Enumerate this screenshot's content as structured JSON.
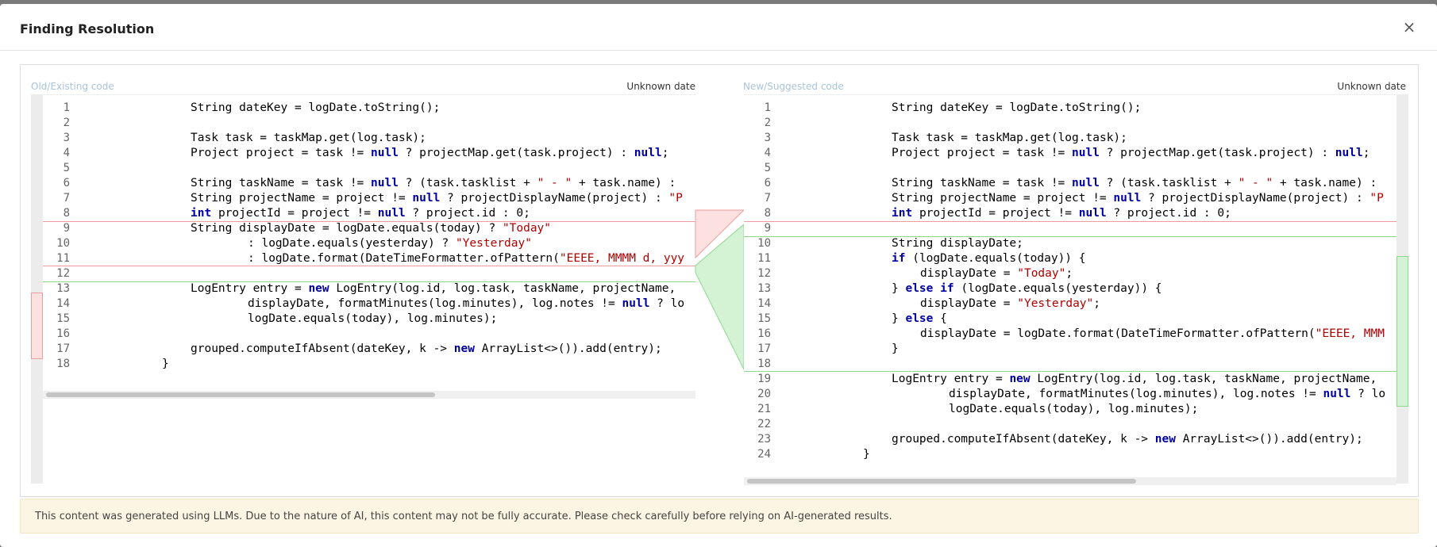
{
  "modal": {
    "title": "Finding Resolution",
    "close_icon": "×"
  },
  "left_pane": {
    "label": "Old/Existing code",
    "date": "Unknown date",
    "lines": [
      {
        "n": "1",
        "c": "String dateKey = logDate.toString();",
        "indent": 0
      },
      {
        "n": "2",
        "c": "",
        "indent": 0
      },
      {
        "n": "3",
        "c": "Task task = taskMap.get(log.task);",
        "indent": 0
      },
      {
        "n": "4",
        "c": "Project project = task != null ? projectMap.get(task.project) : null;",
        "indent": 0
      },
      {
        "n": "5",
        "c": "",
        "indent": 0
      },
      {
        "n": "6",
        "c": "String taskName = task != null ? (task.tasklist + \" - \" + task.name) :",
        "indent": 0
      },
      {
        "n": "7",
        "c": "String projectName = project != null ? projectDisplayName(project) : \"P",
        "indent": 0
      },
      {
        "n": "8",
        "c": "int projectId = project != null ? project.id : 0;",
        "indent": 0
      },
      {
        "n": "9",
        "c": "String displayDate = logDate.equals(today) ? \"Today\"",
        "indent": 0
      },
      {
        "n": "10",
        "c": ": logDate.equals(yesterday) ? \"Yesterday\"",
        "indent": 2
      },
      {
        "n": "11",
        "c": ": logDate.format(DateTimeFormatter.ofPattern(\"EEEE, MMMM d, yyy",
        "indent": 2
      },
      {
        "n": "12",
        "c": "",
        "indent": 0
      },
      {
        "n": "13",
        "c": "LogEntry entry = new LogEntry(log.id, log.task, taskName, projectName,",
        "indent": 0
      },
      {
        "n": "14",
        "c": "displayDate, formatMinutes(log.minutes), log.notes != null ? lo",
        "indent": 2
      },
      {
        "n": "15",
        "c": "logDate.equals(today), log.minutes);",
        "indent": 2
      },
      {
        "n": "16",
        "c": "",
        "indent": 0
      },
      {
        "n": "17",
        "c": "grouped.computeIfAbsent(dateKey, k -> new ArrayList<>()).add(entry);",
        "indent": 0
      },
      {
        "n": "18",
        "c": "}",
        "indent": -1
      }
    ]
  },
  "right_pane": {
    "label": "New/Suggested code",
    "date": "Unknown date",
    "lines": [
      {
        "n": "1",
        "c": "String dateKey = logDate.toString();",
        "indent": 0
      },
      {
        "n": "2",
        "c": "",
        "indent": 0
      },
      {
        "n": "3",
        "c": "Task task = taskMap.get(log.task);",
        "indent": 0
      },
      {
        "n": "4",
        "c": "Project project = task != null ? projectMap.get(task.project) : null;",
        "indent": 0
      },
      {
        "n": "5",
        "c": "",
        "indent": 0
      },
      {
        "n": "6",
        "c": "String taskName = task != null ? (task.tasklist + \" - \" + task.name) :",
        "indent": 0
      },
      {
        "n": "7",
        "c": "String projectName = project != null ? projectDisplayName(project) : \"P",
        "indent": 0
      },
      {
        "n": "8",
        "c": "int projectId = project != null ? project.id : 0;",
        "indent": 0
      },
      {
        "n": "9",
        "c": "",
        "indent": 0
      },
      {
        "n": "10",
        "c": "String displayDate;",
        "indent": 0
      },
      {
        "n": "11",
        "c": "if (logDate.equals(today)) {",
        "indent": 0
      },
      {
        "n": "12",
        "c": "displayDate = \"Today\";",
        "indent": 1
      },
      {
        "n": "13",
        "c": "} else if (logDate.equals(yesterday)) {",
        "indent": 0
      },
      {
        "n": "14",
        "c": "displayDate = \"Yesterday\";",
        "indent": 1
      },
      {
        "n": "15",
        "c": "} else {",
        "indent": 0
      },
      {
        "n": "16",
        "c": "displayDate = logDate.format(DateTimeFormatter.ofPattern(\"EEEE, MMM",
        "indent": 1
      },
      {
        "n": "17",
        "c": "}",
        "indent": 0
      },
      {
        "n": "18",
        "c": "",
        "indent": 0
      },
      {
        "n": "19",
        "c": "LogEntry entry = new LogEntry(log.id, log.task, taskName, projectName,",
        "indent": 0
      },
      {
        "n": "20",
        "c": "displayDate, formatMinutes(log.minutes), log.notes != null ? lo",
        "indent": 2
      },
      {
        "n": "21",
        "c": "logDate.equals(today), log.minutes);",
        "indent": 2
      },
      {
        "n": "22",
        "c": "",
        "indent": 0
      },
      {
        "n": "23",
        "c": "grouped.computeIfAbsent(dateKey, k -> new ArrayList<>()).add(entry);",
        "indent": 0
      },
      {
        "n": "24",
        "c": "}",
        "indent": -1
      }
    ]
  },
  "colors": {
    "removed_fill": "#fde0e0",
    "removed_border": "#ee9c9c",
    "added_fill": "#d4f3d4",
    "added_border": "#8cd98c"
  },
  "disclaimer": {
    "text": "This content was generated using LLMs. Due to the nature of AI, this content may not be fully accurate. Please check carefully before relying on AI-generated results."
  }
}
